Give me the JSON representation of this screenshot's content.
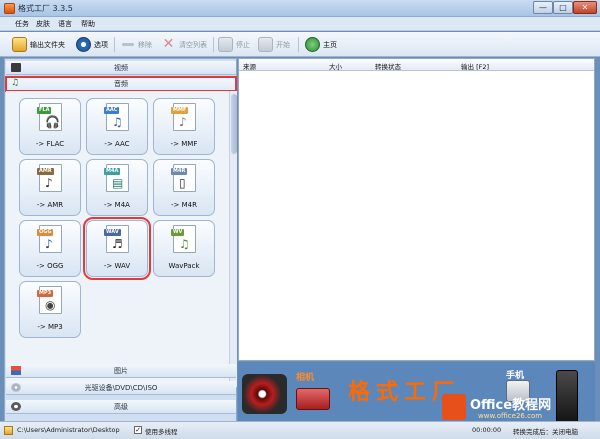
{
  "window": {
    "title": "格式工厂 3.3.5",
    "minimize_label": "—",
    "maximize_label": "□",
    "close_label": "✕"
  },
  "menu": [
    "任务",
    "皮肤",
    "语言",
    "帮助"
  ],
  "toolbar": {
    "output_folder": "输出文件夹",
    "options": "选项",
    "remove": "移除",
    "clear_list": "清空列表",
    "stop": "停止",
    "start": "开始",
    "home": "主页"
  },
  "categories": {
    "video": "视频",
    "audio": "音频",
    "picture": "图片",
    "disc": "光驱设备\\DVD\\CD\\ISO",
    "advanced": "高级"
  },
  "formats": [
    {
      "tag": "FLA",
      "label": "-> FLAC",
      "color": "#3c9a3c",
      "glyph": "🎧"
    },
    {
      "tag": "AAC",
      "label": "-> AAC",
      "color": "#3a7fc8",
      "glyph": "♫"
    },
    {
      "tag": "MMF",
      "label": "-> MMF",
      "color": "#e0a23a",
      "glyph": "♪"
    },
    {
      "tag": "AMR",
      "label": "-> AMR",
      "color": "#8a6a3a",
      "glyph": "♪"
    },
    {
      "tag": "M4A",
      "label": "-> M4A",
      "color": "#3aa0a0",
      "glyph": "▤"
    },
    {
      "tag": "M4R",
      "label": "-> M4R",
      "color": "#6a8ab0",
      "glyph": "▯"
    },
    {
      "tag": "OGG",
      "label": "-> OGG",
      "color": "#e08a3a",
      "glyph": "♪"
    },
    {
      "tag": "WAV",
      "label": "-> WAV",
      "color": "#4a6a9a",
      "glyph": "♬"
    },
    {
      "tag": "WV",
      "label": "WavPack",
      "color": "#6a9a3a",
      "glyph": "♫"
    },
    {
      "tag": "MP3",
      "label": "-> MP3",
      "color": "#d06a3a",
      "glyph": "◉"
    }
  ],
  "list_columns": {
    "source": "来源",
    "size": "大小",
    "status": "转换状态",
    "output": "输出 [F2]"
  },
  "banner": {
    "camera": "相机",
    "brand": "格式工厂",
    "phone": "手机",
    "watermark": "Office教程网",
    "watermark_url": "www.office26.com"
  },
  "status": {
    "path": "C:\\Users\\Administrator\\Desktop",
    "multithread": "使用多线程",
    "elapsed": "00:00:00",
    "after": "转换完成后：关闭电脑"
  },
  "colors": {
    "accent_red": "#e23a3a",
    "toolbar_blue": "#dbe6f3",
    "banner_blue": "#5c87bb"
  }
}
